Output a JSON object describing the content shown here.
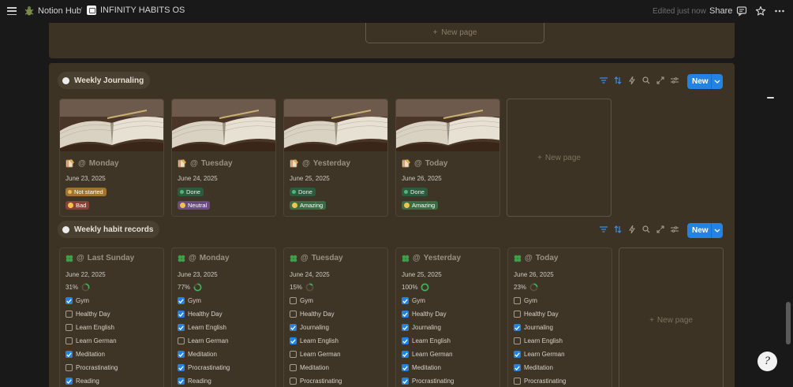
{
  "topbar": {
    "workspace": "Notion Hub",
    "separator": "/",
    "page": "INFINITY HABITS OS",
    "edited": "Edited just now",
    "share": "Share"
  },
  "top_section": {
    "new_page": "New page"
  },
  "journaling": {
    "title": "Weekly Journaling",
    "new_label": "New",
    "new_page": "New page",
    "cards": [
      {
        "at": "@",
        "title": "Monday",
        "date": "June 23, 2025",
        "status": "Not started",
        "status_kind": "notstarted",
        "mood": "Bad",
        "mood_kind": "bad"
      },
      {
        "at": "@",
        "title": "Tuesday",
        "date": "June 24, 2025",
        "status": "Done",
        "status_kind": "done",
        "mood": "Neutral",
        "mood_kind": "neutral"
      },
      {
        "at": "@",
        "title": "Yesterday",
        "date": "June 25, 2025",
        "status": "Done",
        "status_kind": "done",
        "mood": "Amazing",
        "mood_kind": "amazing"
      },
      {
        "at": "@",
        "title": "Today",
        "date": "June 26, 2025",
        "status": "Done",
        "status_kind": "done",
        "mood": "Amazing",
        "mood_kind": "amazing"
      }
    ]
  },
  "habits": {
    "title": "Weekly habit records",
    "new_label": "New",
    "new_page": "New page",
    "cards": [
      {
        "at": "@",
        "title": "Last Sunday",
        "date": "June 22, 2025",
        "pct": "31%",
        "progress": 0.31,
        "items": [
          {
            "label": "Gym",
            "checked": true
          },
          {
            "label": "Healthy Day",
            "checked": false
          },
          {
            "label": "Learn English",
            "checked": false
          },
          {
            "label": "Learn German",
            "checked": false
          },
          {
            "label": "Meditation",
            "checked": true
          },
          {
            "label": "Procrastinating",
            "checked": false
          },
          {
            "label": "Reading",
            "checked": true
          }
        ]
      },
      {
        "at": "@",
        "title": "Monday",
        "date": "June 23, 2025",
        "pct": "77%",
        "progress": 0.77,
        "items": [
          {
            "label": "Gym",
            "checked": true
          },
          {
            "label": "Healthy Day",
            "checked": true
          },
          {
            "label": "Learn English",
            "checked": true
          },
          {
            "label": "Learn German",
            "checked": false
          },
          {
            "label": "Meditation",
            "checked": true
          },
          {
            "label": "Procrastinating",
            "checked": true
          },
          {
            "label": "Reading",
            "checked": true
          }
        ]
      },
      {
        "at": "@",
        "title": "Tuesday",
        "date": "June 24, 2025",
        "pct": "15%",
        "progress": 0.15,
        "items": [
          {
            "label": "Gym",
            "checked": false
          },
          {
            "label": "Healthy Day",
            "checked": false
          },
          {
            "label": "Journaling",
            "checked": true
          },
          {
            "label": "Learn English",
            "checked": true
          },
          {
            "label": "Learn German",
            "checked": false
          },
          {
            "label": "Meditation",
            "checked": false
          },
          {
            "label": "Procrastinating",
            "checked": false
          }
        ]
      },
      {
        "at": "@",
        "title": "Yesterday",
        "date": "June 25, 2025",
        "pct": "100%",
        "progress": 1.0,
        "items": [
          {
            "label": "Gym",
            "checked": true
          },
          {
            "label": "Healthy Day",
            "checked": true
          },
          {
            "label": "Journaling",
            "checked": true
          },
          {
            "label": "Learn English",
            "checked": true
          },
          {
            "label": "Learn German",
            "checked": true
          },
          {
            "label": "Meditation",
            "checked": true
          },
          {
            "label": "Procrastinating",
            "checked": true
          }
        ]
      },
      {
        "at": "@",
        "title": "Today",
        "date": "June 26, 2025",
        "pct": "23%",
        "progress": 0.23,
        "items": [
          {
            "label": "Gym",
            "checked": false
          },
          {
            "label": "Healthy Day",
            "checked": false
          },
          {
            "label": "Journaling",
            "checked": true
          },
          {
            "label": "Learn English",
            "checked": false
          },
          {
            "label": "Learn German",
            "checked": true
          },
          {
            "label": "Meditation",
            "checked": true
          },
          {
            "label": "Procrastinating",
            "checked": false
          }
        ]
      }
    ]
  },
  "help": {
    "label": "?"
  },
  "colors": {
    "accent": "#2383e2",
    "section_bg": "#3c3325",
    "page_bg": "#191919"
  }
}
